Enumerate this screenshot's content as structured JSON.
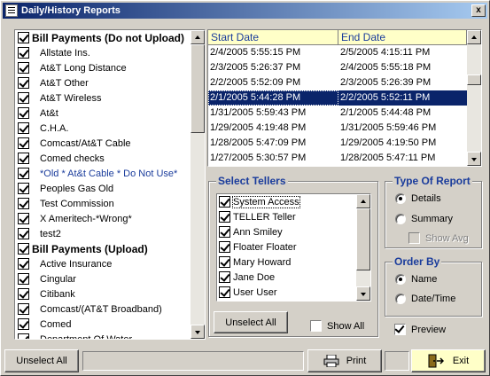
{
  "window": {
    "title": "Daily/History Reports",
    "close_label": "x"
  },
  "bill_list": {
    "rows": [
      {
        "label": "Bill Payments (Do not Upload)",
        "header": true,
        "checked": true
      },
      {
        "label": "Allstate Ins.",
        "checked": true
      },
      {
        "label": "At&T Long Distance",
        "checked": true
      },
      {
        "label": "At&T Other",
        "checked": true
      },
      {
        "label": "At&T Wireless",
        "checked": true
      },
      {
        "label": "At&t",
        "checked": true
      },
      {
        "label": "C.H.A.",
        "checked": true
      },
      {
        "label": "Comcast/At&T Cable",
        "checked": true
      },
      {
        "label": "Comed checks",
        "checked": true
      },
      {
        "label": "*Old * At&t Cable * Do Not Use*",
        "checked": true,
        "blue": true
      },
      {
        "label": "Peoples Gas Old",
        "checked": true
      },
      {
        "label": "Test Commission",
        "checked": true
      },
      {
        "label": "X Ameritech-*Wrong*",
        "checked": true
      },
      {
        "label": "test2",
        "checked": true
      },
      {
        "label": "Bill Payments (Upload)",
        "header": true,
        "checked": true
      },
      {
        "label": "Active Insurance",
        "checked": true
      },
      {
        "label": "Cingular",
        "checked": true
      },
      {
        "label": "Citibank",
        "checked": true
      },
      {
        "label": "Comcast/(AT&T Broadband)",
        "checked": true
      },
      {
        "label": "Comed",
        "checked": true
      },
      {
        "label": "Department Of Water",
        "checked": true
      }
    ]
  },
  "dates": {
    "headers": [
      "Start Date",
      "End Date"
    ],
    "rows": [
      [
        "2/4/2005 5:55:15 PM",
        "2/5/2005 4:15:11 PM"
      ],
      [
        "2/3/2005 5:26:37 PM",
        "2/4/2005 5:55:18 PM"
      ],
      [
        "2/2/2005 5:52:09 PM",
        "2/3/2005 5:26:39 PM"
      ],
      [
        "2/1/2005 5:44:28 PM",
        "2/2/2005 5:52:11 PM"
      ],
      [
        "1/31/2005 5:59:43 PM",
        "2/1/2005 5:44:48 PM"
      ],
      [
        "1/29/2005 4:19:48 PM",
        "1/31/2005 5:59:46 PM"
      ],
      [
        "1/28/2005 5:47:09 PM",
        "1/29/2005 4:19:50 PM"
      ],
      [
        "1/27/2005 5:30:57 PM",
        "1/28/2005 5:47:11 PM"
      ]
    ],
    "selected_index": 3
  },
  "tellers": {
    "legend": "Select Tellers",
    "rows": [
      {
        "label": "System Access",
        "checked": true
      },
      {
        "label": "TELLER Teller",
        "checked": true
      },
      {
        "label": "Ann Smiley",
        "checked": true
      },
      {
        "label": "Floater Floater",
        "checked": true
      },
      {
        "label": "Mary Howard",
        "checked": true
      },
      {
        "label": "Jane Doe",
        "checked": true
      },
      {
        "label": "User User",
        "checked": true
      }
    ],
    "unselect_all": "Unselect All",
    "show_all": "Show All"
  },
  "report_type": {
    "legend": "Type Of Report",
    "details": "Details",
    "summary": "Summary",
    "show_avg": "Show Avg",
    "selected": "Details"
  },
  "order_by": {
    "legend": "Order By",
    "name": "Name",
    "date_time": "Date/Time",
    "selected": "Name"
  },
  "preview": {
    "label": "Preview",
    "checked": true
  },
  "bottom": {
    "unselect_all": "Unselect All",
    "print": "Print",
    "exit": "Exit"
  },
  "colors": {
    "title_start": "#0a246a",
    "title_end": "#a6caf0",
    "selection": "#0a246a",
    "accent_text": "#1a3c9c",
    "header_bg": "#ffffc8",
    "exit_bg": "#ffffc8"
  }
}
